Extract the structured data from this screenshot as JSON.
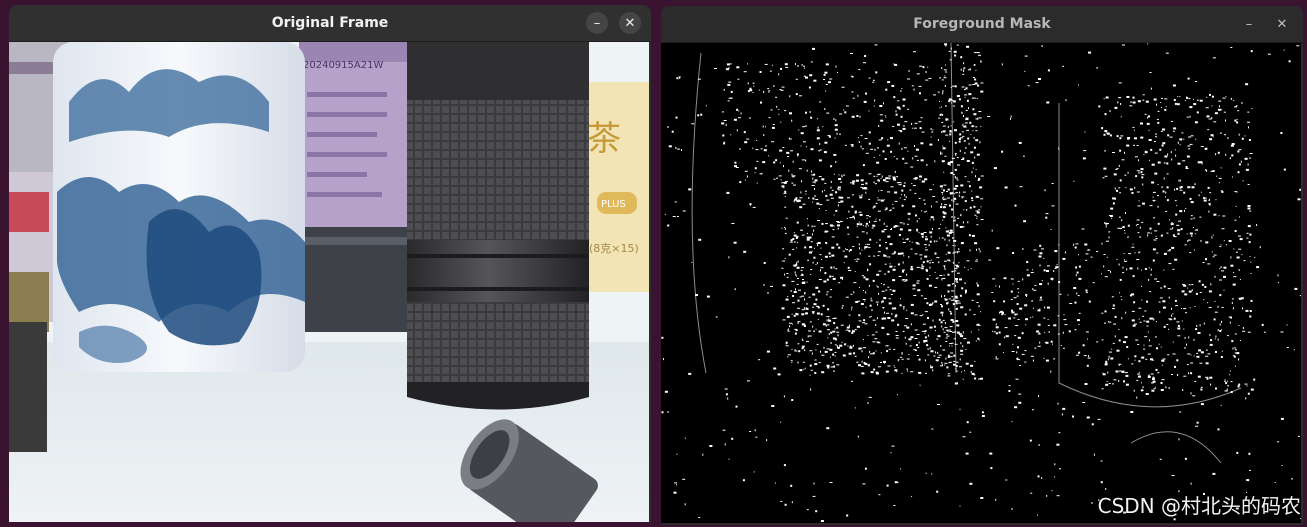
{
  "windows": {
    "left": {
      "title": "Original Frame",
      "minimize_glyph": "–",
      "close_glyph": "✕"
    },
    "right": {
      "title": "Foreground Mask",
      "minimize_glyph": "–",
      "close_glyph": "✕"
    }
  },
  "frame_text": {
    "canister_code": "20240915A21W",
    "box_char": "茶",
    "box_badge": "PLUS",
    "box_note": "(8克×15)"
  },
  "watermark": "CSDN @村北头的码农",
  "icons": [
    "minimize-icon",
    "close-icon"
  ],
  "colors": {
    "desktop": "#3a1330",
    "titlebar": "#2b2b2b",
    "mask_fg": "#ffffff",
    "mask_bg": "#000000"
  }
}
